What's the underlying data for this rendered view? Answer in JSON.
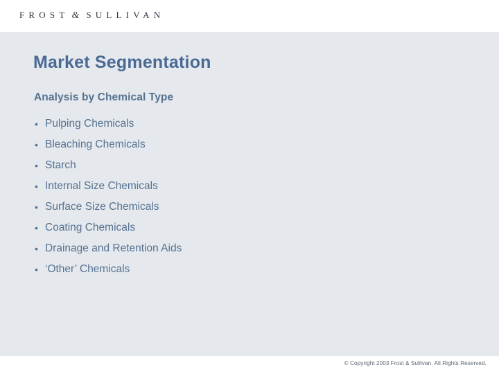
{
  "header": {
    "logo": {
      "word1": "FROST",
      "ampersand": "&",
      "word2": "SULLIVAN"
    }
  },
  "slide": {
    "title": "Market Segmentation",
    "subtitle": "Analysis by Chemical Type",
    "bullet_marker": "•",
    "bullets": [
      {
        "label": "Pulping Chemicals"
      },
      {
        "label": "Bleaching Chemicals"
      },
      {
        "label": "Starch"
      },
      {
        "label": "Internal Size Chemicals"
      },
      {
        "label": "Surface Size Chemicals"
      },
      {
        "label": "Coating Chemicals"
      },
      {
        "label": "Drainage and Retention Aids"
      },
      {
        "label": "‘Other’ Chemicals"
      }
    ]
  },
  "footer": {
    "copyright": "© Copyright 2003 Frost & Sullivan. All Rights Reserved."
  },
  "colors": {
    "body_background": "#e5e9ee",
    "band_background": "#ffffff",
    "title_text": "#4a6a94",
    "body_text": "#55718f",
    "logo_text": "#2d3440",
    "footer_text": "#56616e"
  }
}
